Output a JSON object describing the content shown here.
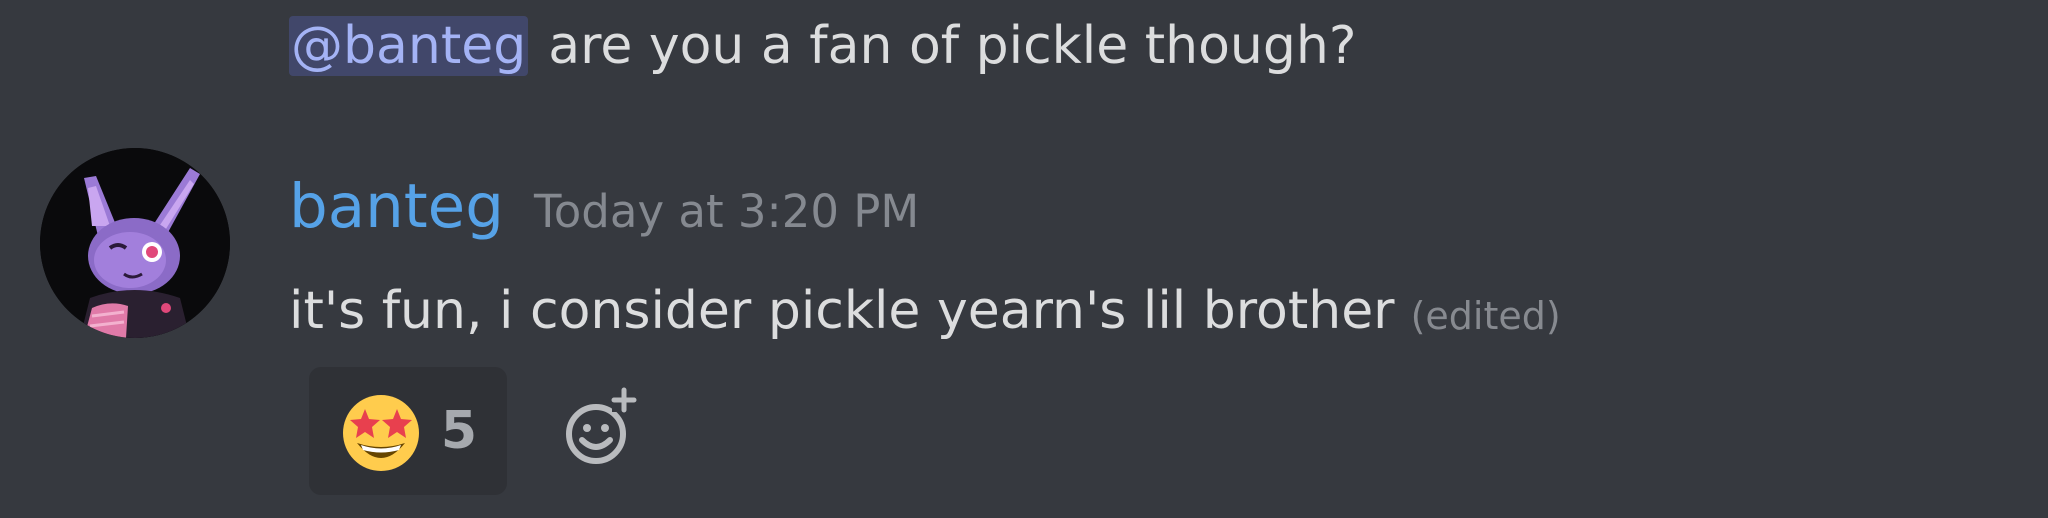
{
  "previous_message": {
    "mention": "@banteg",
    "text": "are you a fan of pickle though?"
  },
  "message": {
    "author": "banteg",
    "timestamp": "Today at 3:20 PM",
    "text": "it's fun, i consider pickle yearn's lil brother",
    "edited_label": "(edited)",
    "avatar_icon": "purple-bunny-avatar"
  },
  "reactions": [
    {
      "emoji_icon": "star-struck-emoji-icon",
      "count": "5"
    }
  ],
  "add_reaction_icon": "add-reaction-icon",
  "colors": {
    "background": "#36393f",
    "username": "#56a2e7",
    "mention_bg": "#41476a",
    "mention_text": "#a4b3f5",
    "reaction_bg": "#2f3136"
  }
}
